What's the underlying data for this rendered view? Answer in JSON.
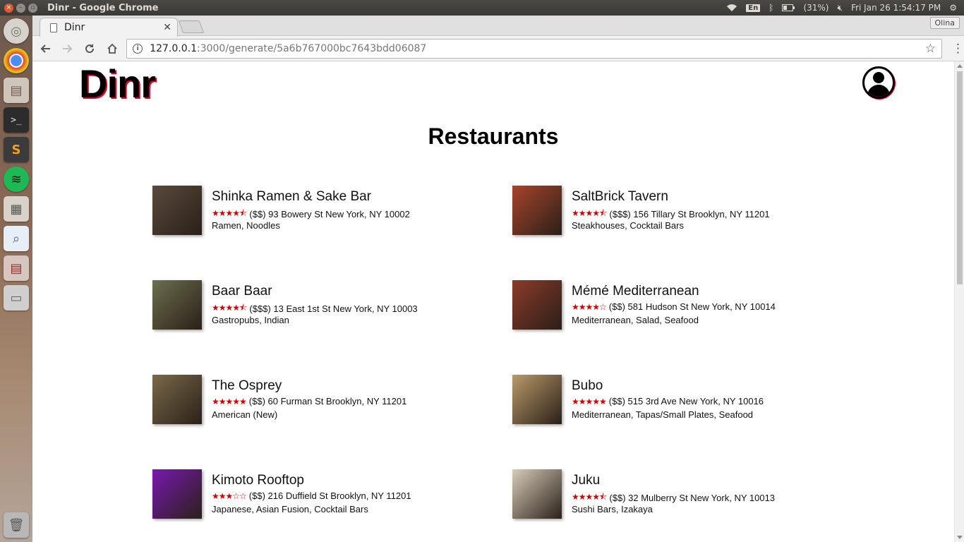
{
  "os_panel": {
    "window_title": "Dinr - Google Chrome",
    "keyboard": "En",
    "battery": "(31%)",
    "clock": "Fri Jan 26  1:54:17 PM"
  },
  "browser": {
    "tab_title": "Dinr",
    "profile_name": "Olina",
    "url_host": "127.0.0.1",
    "url_rest": ":3000/generate/5a6b767000bc7643bdd06087"
  },
  "site": {
    "logo": "Dinr",
    "page_title": "Restaurants"
  },
  "restaurants": [
    {
      "name": "Shinka Ramen & Sake Bar",
      "stars": "★★★★⯪",
      "rating": 4.5,
      "price": "($$)",
      "address": "93 Bowery St New York, NY 10002",
      "categories": "Ramen, Noodles",
      "thumb_color": "#5a4a3c"
    },
    {
      "name": "SaltBrick Tavern",
      "stars": "★★★★⯪",
      "rating": 4.5,
      "price": "($$$)",
      "address": "156 Tillary St Brooklyn, NY 11201",
      "categories": "Steakhouses, Cocktail Bars",
      "thumb_color": "#a8442c"
    },
    {
      "name": "Baar Baar",
      "stars": "★★★★⯪",
      "rating": 4.5,
      "price": "($$$)",
      "address": "13 East 1st St New York, NY 10003",
      "categories": "Gastropubs, Indian",
      "thumb_color": "#6c6f4e"
    },
    {
      "name": "Mémé Mediterranean",
      "stars": "★★★★☆",
      "rating": 4,
      "price": "($$)",
      "address": "581 Hudson St New York, NY 10014",
      "categories": "Mediterranean, Salad, Seafood",
      "thumb_color": "#8c3a2a"
    },
    {
      "name": "The Osprey",
      "stars": "★★★★★",
      "rating": 5,
      "price": "($$)",
      "address": "60 Furman St Brooklyn, NY 11201",
      "categories": "American (New)",
      "thumb_color": "#7a6a4a"
    },
    {
      "name": "Bubo",
      "stars": "★★★★★",
      "rating": 5,
      "price": "($$)",
      "address": "515 3rd Ave New York, NY 10016",
      "categories": "Mediterranean, Tapas/Small Plates, Seafood",
      "thumb_color": "#b99a6a"
    },
    {
      "name": "Kimoto Rooftop",
      "stars": "★★★☆☆",
      "rating": 3,
      "price": "($$)",
      "address": "216 Duffield St Brooklyn, NY 11201",
      "categories": "Japanese, Asian Fusion, Cocktail Bars",
      "thumb_color": "#7a18b0"
    },
    {
      "name": "Juku",
      "stars": "★★★★⯪",
      "rating": 4.5,
      "price": "($$)",
      "address": "32 Mulberry St New York, NY 10013",
      "categories": "Sushi Bars, Izakaya",
      "thumb_color": "#d8cdb8"
    }
  ]
}
